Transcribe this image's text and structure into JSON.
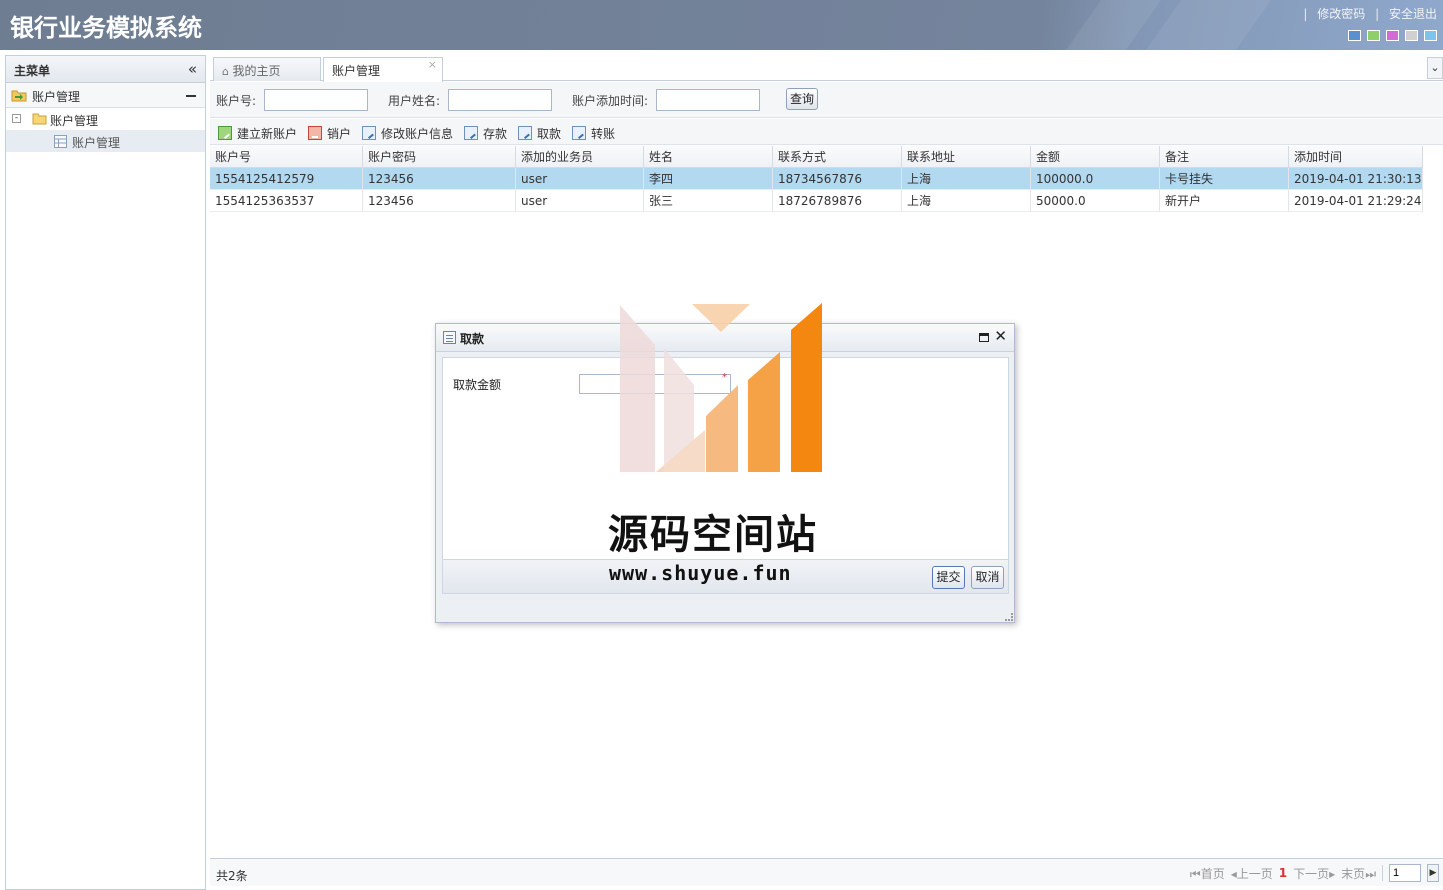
{
  "app": {
    "title": "银行业务模拟系统",
    "top_links": [
      "修改密码",
      "安全退出"
    ],
    "theme_colors": [
      "#5b8fd0",
      "#8fcf6a",
      "#d46ad6",
      "#d0d0d0",
      "#7cc4ea"
    ]
  },
  "sidebar": {
    "title": "主菜单",
    "accordion_title": "账户管理",
    "tree_folder": "账户管理",
    "tree_leaf": "账户管理"
  },
  "tabs": [
    {
      "label": "我的主页"
    },
    {
      "label": "账户管理"
    }
  ],
  "search": {
    "account_label": "账户号:",
    "account_value": "",
    "username_label": "用户姓名:",
    "username_value": "",
    "date_label": "账户添加时间:",
    "date_value": "",
    "query_button": "查询"
  },
  "toolbar": {
    "items": [
      "建立新账户",
      "销户",
      "修改账户信息",
      "存款",
      "取款",
      "转账"
    ]
  },
  "table": {
    "columns": [
      "账户号",
      "账户密码",
      "添加的业务员",
      "姓名",
      "联系方式",
      "联系地址",
      "金额",
      "备注",
      "添加时间"
    ],
    "rows": [
      [
        "1554125412579",
        "123456",
        "user",
        "李四",
        "18734567876",
        "上海",
        "100000.0",
        "卡号挂失",
        "2019-04-01 21:30:13"
      ],
      [
        "1554125363537",
        "123456",
        "user",
        "张三",
        "18726789876",
        "上海",
        "50000.0",
        "新开户",
        "2019-04-01 21:29:24"
      ]
    ],
    "selected_row": 0
  },
  "footer": {
    "total": "共2条",
    "first": "首页",
    "prev": "上一页",
    "current_page": "1",
    "next": "下一页",
    "last": "末页",
    "page_input": "1"
  },
  "dialog": {
    "title": "取款",
    "field_label": "取款金额",
    "field_value": "",
    "required_mark": "*",
    "submit": "提交",
    "cancel": "取消"
  },
  "watermark": {
    "text": "源码空间站",
    "url": "www.shuyue.fun"
  }
}
